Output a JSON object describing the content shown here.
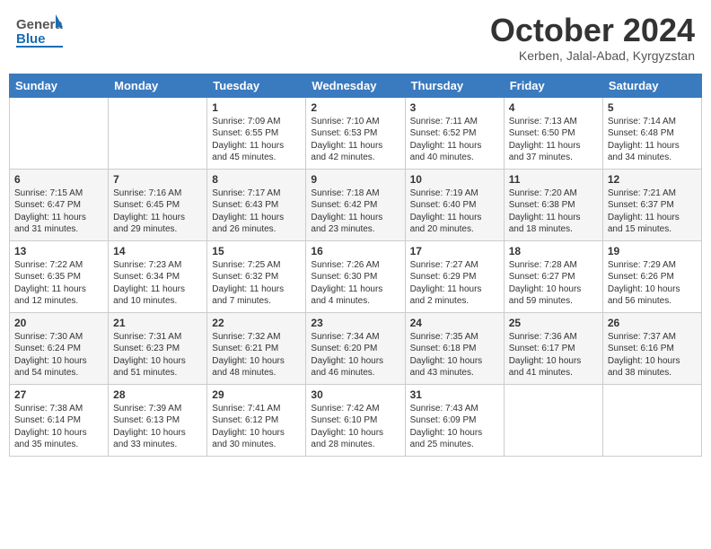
{
  "header": {
    "logo_general": "General",
    "logo_blue": "Blue",
    "month_title": "October 2024",
    "location": "Kerben, Jalal-Abad, Kyrgyzstan"
  },
  "weekdays": [
    "Sunday",
    "Monday",
    "Tuesday",
    "Wednesday",
    "Thursday",
    "Friday",
    "Saturday"
  ],
  "weeks": [
    [
      {
        "day": "",
        "info": ""
      },
      {
        "day": "",
        "info": ""
      },
      {
        "day": "1",
        "info": "Sunrise: 7:09 AM\nSunset: 6:55 PM\nDaylight: 11 hours and 45 minutes."
      },
      {
        "day": "2",
        "info": "Sunrise: 7:10 AM\nSunset: 6:53 PM\nDaylight: 11 hours and 42 minutes."
      },
      {
        "day": "3",
        "info": "Sunrise: 7:11 AM\nSunset: 6:52 PM\nDaylight: 11 hours and 40 minutes."
      },
      {
        "day": "4",
        "info": "Sunrise: 7:13 AM\nSunset: 6:50 PM\nDaylight: 11 hours and 37 minutes."
      },
      {
        "day": "5",
        "info": "Sunrise: 7:14 AM\nSunset: 6:48 PM\nDaylight: 11 hours and 34 minutes."
      }
    ],
    [
      {
        "day": "6",
        "info": "Sunrise: 7:15 AM\nSunset: 6:47 PM\nDaylight: 11 hours and 31 minutes."
      },
      {
        "day": "7",
        "info": "Sunrise: 7:16 AM\nSunset: 6:45 PM\nDaylight: 11 hours and 29 minutes."
      },
      {
        "day": "8",
        "info": "Sunrise: 7:17 AM\nSunset: 6:43 PM\nDaylight: 11 hours and 26 minutes."
      },
      {
        "day": "9",
        "info": "Sunrise: 7:18 AM\nSunset: 6:42 PM\nDaylight: 11 hours and 23 minutes."
      },
      {
        "day": "10",
        "info": "Sunrise: 7:19 AM\nSunset: 6:40 PM\nDaylight: 11 hours and 20 minutes."
      },
      {
        "day": "11",
        "info": "Sunrise: 7:20 AM\nSunset: 6:38 PM\nDaylight: 11 hours and 18 minutes."
      },
      {
        "day": "12",
        "info": "Sunrise: 7:21 AM\nSunset: 6:37 PM\nDaylight: 11 hours and 15 minutes."
      }
    ],
    [
      {
        "day": "13",
        "info": "Sunrise: 7:22 AM\nSunset: 6:35 PM\nDaylight: 11 hours and 12 minutes."
      },
      {
        "day": "14",
        "info": "Sunrise: 7:23 AM\nSunset: 6:34 PM\nDaylight: 11 hours and 10 minutes."
      },
      {
        "day": "15",
        "info": "Sunrise: 7:25 AM\nSunset: 6:32 PM\nDaylight: 11 hours and 7 minutes."
      },
      {
        "day": "16",
        "info": "Sunrise: 7:26 AM\nSunset: 6:30 PM\nDaylight: 11 hours and 4 minutes."
      },
      {
        "day": "17",
        "info": "Sunrise: 7:27 AM\nSunset: 6:29 PM\nDaylight: 11 hours and 2 minutes."
      },
      {
        "day": "18",
        "info": "Sunrise: 7:28 AM\nSunset: 6:27 PM\nDaylight: 10 hours and 59 minutes."
      },
      {
        "day": "19",
        "info": "Sunrise: 7:29 AM\nSunset: 6:26 PM\nDaylight: 10 hours and 56 minutes."
      }
    ],
    [
      {
        "day": "20",
        "info": "Sunrise: 7:30 AM\nSunset: 6:24 PM\nDaylight: 10 hours and 54 minutes."
      },
      {
        "day": "21",
        "info": "Sunrise: 7:31 AM\nSunset: 6:23 PM\nDaylight: 10 hours and 51 minutes."
      },
      {
        "day": "22",
        "info": "Sunrise: 7:32 AM\nSunset: 6:21 PM\nDaylight: 10 hours and 48 minutes."
      },
      {
        "day": "23",
        "info": "Sunrise: 7:34 AM\nSunset: 6:20 PM\nDaylight: 10 hours and 46 minutes."
      },
      {
        "day": "24",
        "info": "Sunrise: 7:35 AM\nSunset: 6:18 PM\nDaylight: 10 hours and 43 minutes."
      },
      {
        "day": "25",
        "info": "Sunrise: 7:36 AM\nSunset: 6:17 PM\nDaylight: 10 hours and 41 minutes."
      },
      {
        "day": "26",
        "info": "Sunrise: 7:37 AM\nSunset: 6:16 PM\nDaylight: 10 hours and 38 minutes."
      }
    ],
    [
      {
        "day": "27",
        "info": "Sunrise: 7:38 AM\nSunset: 6:14 PM\nDaylight: 10 hours and 35 minutes."
      },
      {
        "day": "28",
        "info": "Sunrise: 7:39 AM\nSunset: 6:13 PM\nDaylight: 10 hours and 33 minutes."
      },
      {
        "day": "29",
        "info": "Sunrise: 7:41 AM\nSunset: 6:12 PM\nDaylight: 10 hours and 30 minutes."
      },
      {
        "day": "30",
        "info": "Sunrise: 7:42 AM\nSunset: 6:10 PM\nDaylight: 10 hours and 28 minutes."
      },
      {
        "day": "31",
        "info": "Sunrise: 7:43 AM\nSunset: 6:09 PM\nDaylight: 10 hours and 25 minutes."
      },
      {
        "day": "",
        "info": ""
      },
      {
        "day": "",
        "info": ""
      }
    ]
  ]
}
